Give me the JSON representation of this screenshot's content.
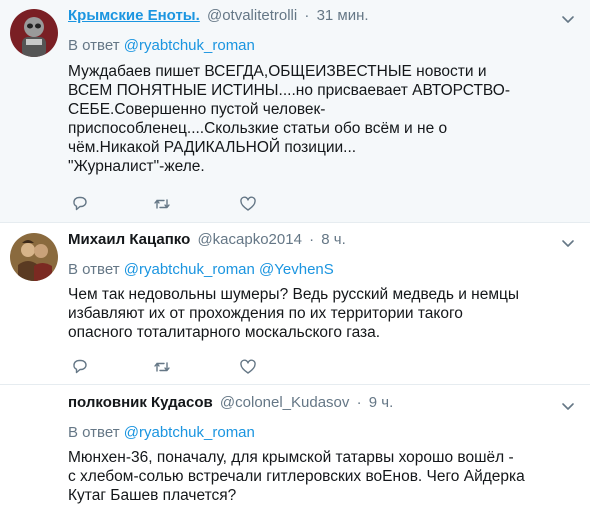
{
  "tweets": [
    {
      "name": "Крымские Еноты.",
      "handle": "@otvalitetrolli",
      "dot": "·",
      "time": "31 мин.",
      "reply_prefix": "В ответ",
      "reply_mentions": "@ryabtchuk_roman",
      "text": "Муждабаев пишет ВСЕГДА,ОБЩЕИЗВЕСТНЫЕ новости и\nВСЕМ ПОНЯТНЫЕ ИСТИНЫ....но присваевает АВТОРСТВО-\nСЕБЕ.Совершенно пустой человек-\nприспособленец....Скользкие статьи обо всём и не о\nчём.Никакой РАДИКАЛЬНОЙ позиции...\n\"Журналист\"-желе."
    },
    {
      "name": "Михаил Кацапко",
      "handle": "@kacapko2014",
      "dot": "·",
      "time": "8 ч.",
      "reply_prefix": "В ответ",
      "reply_mentions": "@ryabtchuk_roman @YevhenS",
      "text": "Чем так недовольны шумеры? Ведь русский медведь и немцы\nизбавляют их от прохождения по их территории такого\nопасного тоталитарного москальского газа."
    },
    {
      "name": "полковник Кудасов",
      "handle": "@colonel_Kudasov",
      "dot": "·",
      "time": "9 ч.",
      "reply_prefix": "В ответ",
      "reply_mentions": "@ryabtchuk_roman",
      "text": "Мюнхен-36, поначалу, для крымской татарвы хорошо вошёл -\nс хлебом-солью встречали гитлеровских воЕнов. Чего Айдерка\nКутаг Башев плачется?"
    }
  ],
  "colors": {
    "link": "#1b95e0",
    "muted": "#657786",
    "text": "#14171a",
    "highlight_bg": "#f5f8fa",
    "divider": "#e6ecf0"
  },
  "icons": [
    "chevron-down-icon",
    "reply-icon",
    "retweet-icon",
    "like-icon"
  ]
}
